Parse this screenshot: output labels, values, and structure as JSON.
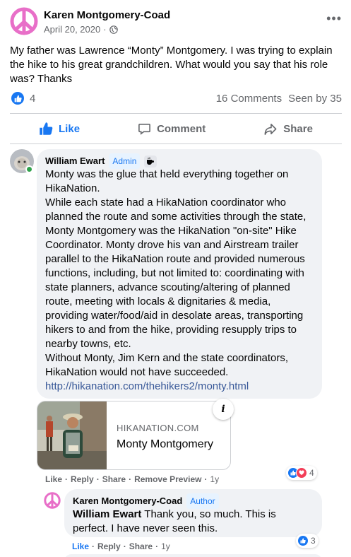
{
  "post": {
    "author": "Karen Montgomery-Coad",
    "date": "April 20, 2020",
    "separator": "·",
    "text": "My father was Lawrence “Monty” Montgomery.  I was trying to explain the hike to his great grandchildren.  What would you say that his role was?  Thanks",
    "more": "•••",
    "likes": "4",
    "comments": "16 Comments",
    "seen": "Seen by 35"
  },
  "actions": {
    "like": "Like",
    "comment": "Comment",
    "share": "Share"
  },
  "comment1": {
    "author": "William Ewart",
    "badge": "Admin",
    "paragraphs": [
      "Monty was the glue that held everything together on HikaNation.",
      "While each state had a HikaNation coordinator who planned the route and some activities through the state, Monty Montgomery was the HikaNation \"on-site\" Hike Coordinator. Monty drove his van and Airstream trailer parallel to the HikaNation route and provided numerous functions, including, but not limited to: coordinating with state planners, advance scouting/altering of planned route, meeting with locals & dignitaries & media, providing water/food/aid in desolate areas, transporting hikers to and from the hike, providing resupply trips to nearby towns, etc.",
      "Without Monty, Jim Kern and the state coordinators, HikaNation would not have succeeded."
    ],
    "link": "http://hikanation.com/thehikers2/monty.html",
    "preview": {
      "domain": "HIKANATION.COM",
      "title": "Monty Montgomery",
      "info": "i"
    },
    "actions": {
      "like": "Like",
      "reply": "Reply",
      "share": "Share",
      "remove_preview": "Remove Preview",
      "time": "1y"
    },
    "reactions": "4"
  },
  "reply1": {
    "author": "Karen Montgomery-Coad",
    "badge": "Author",
    "tag": "William Ewart",
    "text": "Thank you, so much. This is perfect. I have never seen this.",
    "actions": {
      "like": "Like",
      "reply": "Reply",
      "share": "Share",
      "time": "1y"
    },
    "reactions": "3"
  },
  "colors": {
    "brand_blue": "#1877f2",
    "bubble_bg": "#f0f2f5",
    "secondary_text": "#65676b",
    "peace_pink": "#e86fc8",
    "online_green": "#31a24c"
  },
  "icons": {
    "globe": "globe-icon",
    "like": "thumbs-up-icon",
    "comment": "speech-bubble-icon",
    "share": "share-arrow-icon",
    "peace": "peace-sign-icon",
    "coffee": "coffee-cup-icon",
    "love": "heart-icon",
    "info": "info-icon"
  }
}
